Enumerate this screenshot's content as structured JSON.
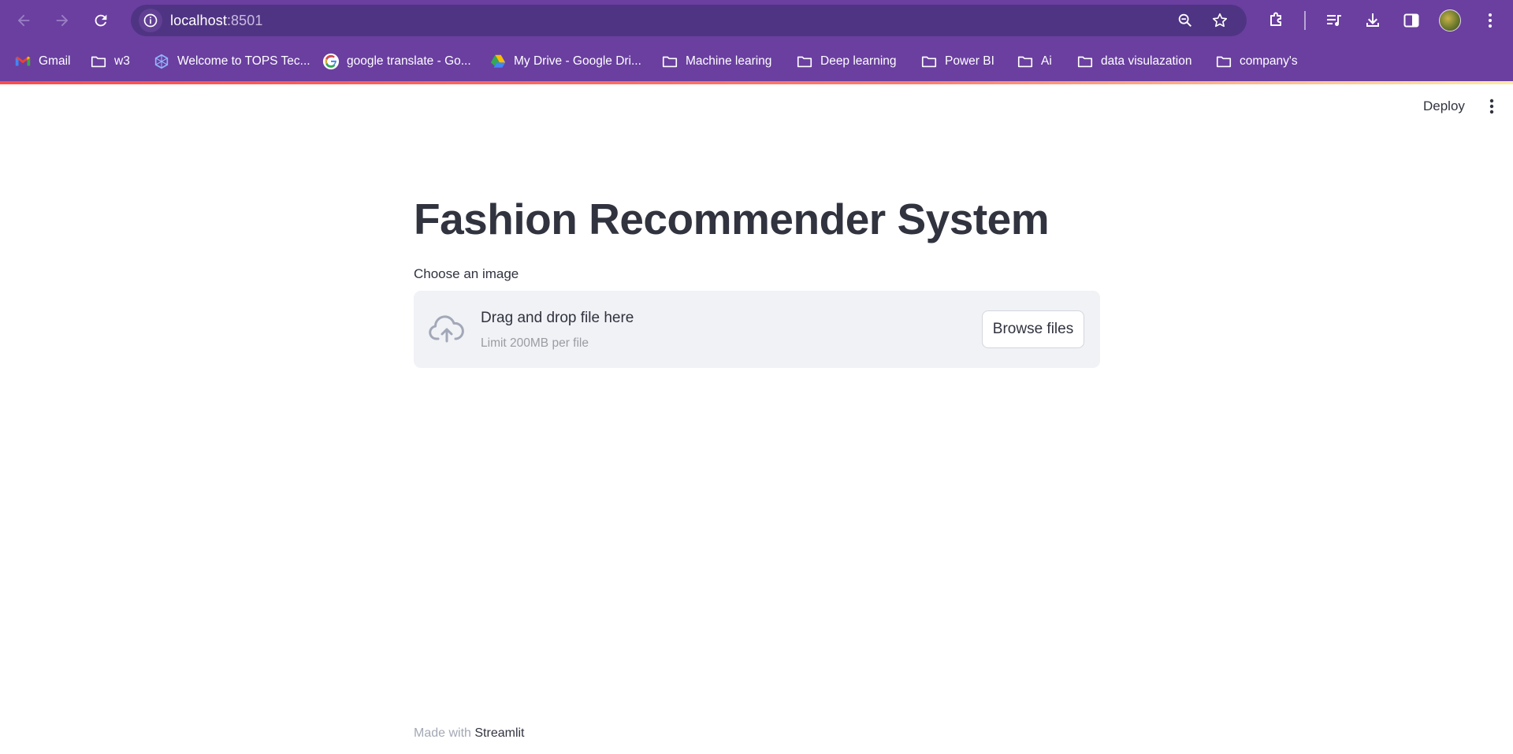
{
  "browser": {
    "url_host": "localhost",
    "url_port": ":8501"
  },
  "bookmarks": [
    {
      "label": "Gmail",
      "icon": "gmail-icon"
    },
    {
      "label": "w3",
      "icon": "folder-icon"
    },
    {
      "label": "Welcome to TOPS Tec...",
      "icon": "tops-logo-icon"
    },
    {
      "label": "google translate - Go...",
      "icon": "google-icon"
    },
    {
      "label": "My Drive - Google Dri...",
      "icon": "google-drive-icon"
    },
    {
      "label": "Machine learing",
      "icon": "folder-icon"
    },
    {
      "label": "Deep learning",
      "icon": "folder-icon"
    },
    {
      "label": "Power BI",
      "icon": "folder-icon"
    },
    {
      "label": "Ai",
      "icon": "folder-icon"
    },
    {
      "label": "data visulazation",
      "icon": "folder-icon"
    },
    {
      "label": "company's",
      "icon": "folder-icon"
    }
  ],
  "header": {
    "deploy_label": "Deploy"
  },
  "main": {
    "title": "Fashion Recommender System",
    "uploader": {
      "label": "Choose an image",
      "drop_text": "Drag and drop file here",
      "limit_text": "Limit 200MB per file",
      "browse_label": "Browse files"
    }
  },
  "footer": {
    "made_with": "Made with ",
    "brand": "Streamlit"
  },
  "colors": {
    "chrome": "#6a3fa0",
    "omnibox": "#4f3483",
    "text": "#31333f",
    "dropzone": "#f0f2f6",
    "accent": "#ff4b4b"
  }
}
